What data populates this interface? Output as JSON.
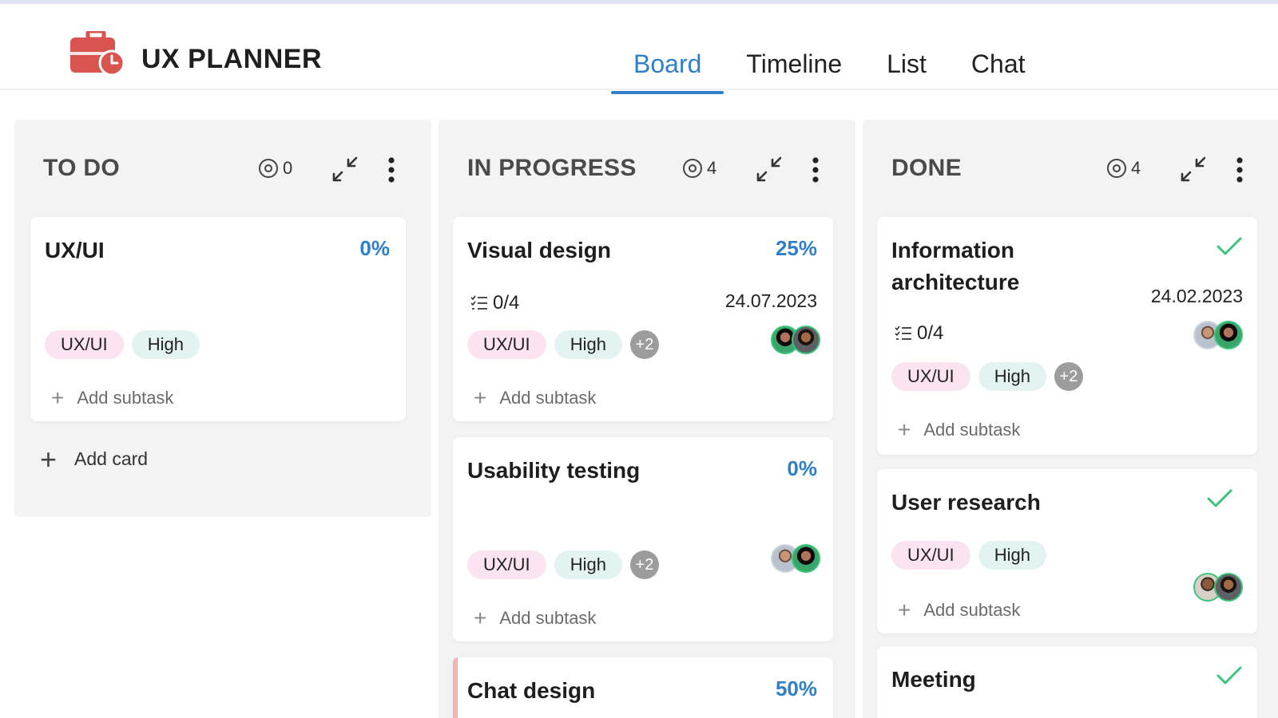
{
  "app": {
    "title": "UX PLANNER"
  },
  "tabs": [
    {
      "label": "Board",
      "active": true
    },
    {
      "label": "Timeline",
      "active": false
    },
    {
      "label": "List",
      "active": false
    },
    {
      "label": "Chat",
      "active": false
    }
  ],
  "colors": {
    "accent": "#2f7fc9",
    "logo": "#d9534f",
    "check": "#3bc47a",
    "tag_uxui": "#fbe3f1",
    "tag_high": "#e3f3f1"
  },
  "columns": {
    "todo": {
      "title": "TO DO",
      "count": "0",
      "add_card": "Add card",
      "cards": [
        {
          "title": "UX/UI",
          "percent": "0%",
          "tags": [
            "UX/UI",
            "High"
          ],
          "add_subtask": "Add subtask"
        }
      ]
    },
    "inprogress": {
      "title": "IN PROGRESS",
      "count": "4",
      "cards": [
        {
          "title": "Visual design",
          "percent": "25%",
          "subtasks": "0/4",
          "date": "24.07.2023",
          "tags": [
            "UX/UI",
            "High"
          ],
          "more": "+2",
          "add_subtask": "Add subtask"
        },
        {
          "title": "Usability testing",
          "percent": "0%",
          "tags": [
            "UX/UI",
            "High"
          ],
          "more": "+2",
          "add_subtask": "Add subtask"
        },
        {
          "title": "Chat design",
          "percent": "50%"
        }
      ]
    },
    "done": {
      "title": "DONE",
      "count": "4",
      "cards": [
        {
          "title_line1": "Information",
          "title_line2": "architecture",
          "date": "24.02.2023",
          "subtasks": "0/4",
          "tags": [
            "UX/UI",
            "High"
          ],
          "more": "+2",
          "add_subtask": "Add subtask"
        },
        {
          "title": "User research",
          "tags": [
            "UX/UI",
            "High"
          ],
          "add_subtask": "Add subtask"
        },
        {
          "title": "Meeting"
        }
      ]
    }
  },
  "icons": {
    "logo": "briefcase-clock-icon",
    "count": "target-icon",
    "collapse": "collapse-arrows-icon",
    "more": "kebab-menu-icon",
    "check": "check-icon",
    "subtasks": "checklist-icon",
    "add": "plus-icon"
  }
}
